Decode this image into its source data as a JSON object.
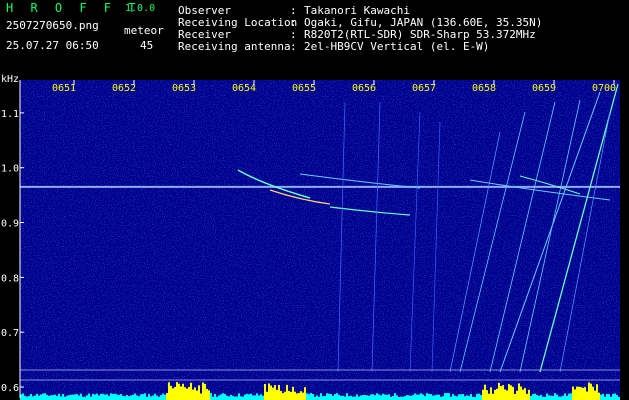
{
  "header": {
    "app_name": "H R O F F T",
    "version": "1.0.0",
    "file_name": "2507270650.png",
    "meteor_label": "meteor",
    "date_time": "25.07.27 06:50",
    "meteor_count": "45",
    "info": [
      {
        "label": "Observer",
        "value": "Takanori Kawachi"
      },
      {
        "label": "Receiving Location",
        "value": "Ogaki, Gifu, JAPAN (136.60E, 35.35N)"
      },
      {
        "label": "Receiver",
        "value": "R820T2(RTL-SDR) SDR-Sharp 53.372MHz"
      },
      {
        "label": "Receiving antenna",
        "value": "2el-HB9CV Vertical (el. E-W)"
      }
    ]
  },
  "spectrogram": {
    "unit_label": "kHz",
    "time_ticks": [
      "0651",
      "0652",
      "0653",
      "0654",
      "0655",
      "0656",
      "0657",
      "0658",
      "0659",
      "0700"
    ],
    "freq_ticks": [
      1.1,
      1.0,
      0.9,
      0.8,
      0.7,
      0.6
    ],
    "freq_range": [
      0.58,
      1.16
    ],
    "carrier_freq": 0.965,
    "colors": {
      "background": "#00008c",
      "axis": "#ffffff",
      "tick_labels": "#ffff00",
      "streak": "#66ffcc",
      "level_bar": "#00ffff",
      "level_bar_peak": "#ffff00"
    }
  }
}
